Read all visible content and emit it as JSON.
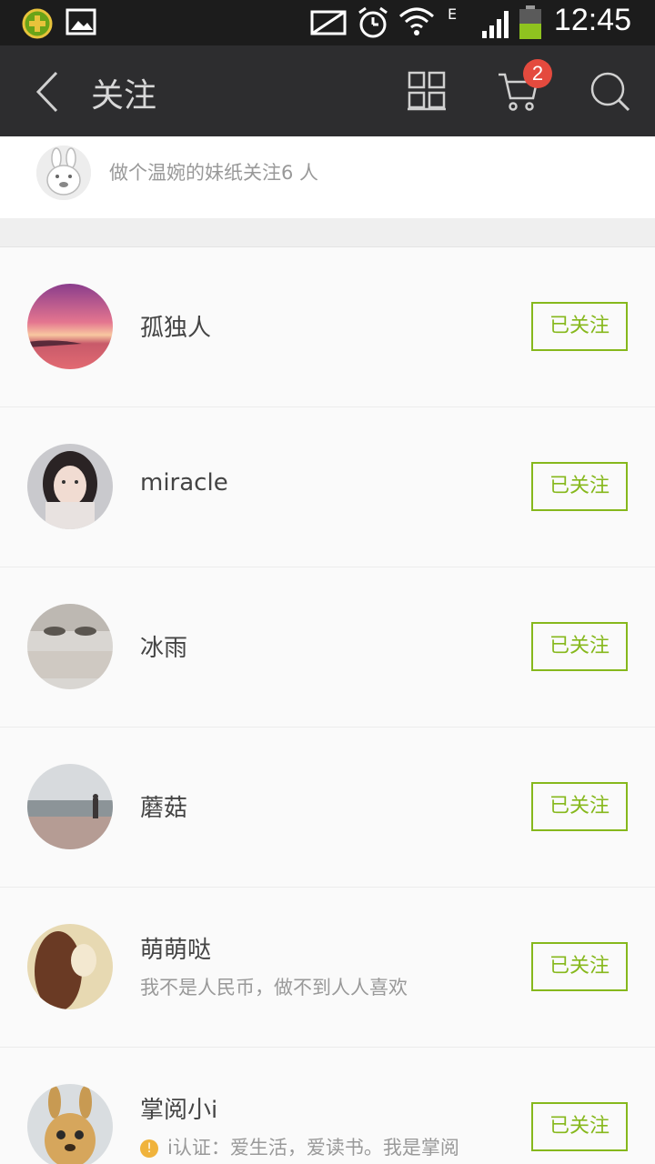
{
  "status_bar": {
    "time": "12:45",
    "network": "E"
  },
  "navbar": {
    "title": "关注",
    "cart_count": "2"
  },
  "summary": {
    "text": "做个温婉的妹纸关注6 人"
  },
  "list": [
    {
      "name": "孤独人",
      "bio": "",
      "button": "已关注"
    },
    {
      "name": "miracle",
      "bio": "",
      "button": "已关注"
    },
    {
      "name": "冰雨",
      "bio": "",
      "button": "已关注"
    },
    {
      "name": "蘑菇",
      "bio": "",
      "button": "已关注"
    },
    {
      "name": "萌萌哒",
      "bio": "我不是人民币，做不到人人喜欢",
      "button": "已关注"
    },
    {
      "name": "掌阅小i",
      "bio": "i认证：爱生活，爱读书。我是掌阅",
      "button": "已关注",
      "verified_icon": "!"
    }
  ],
  "colors": {
    "accent": "#86b81c",
    "navbar": "#2d2d2f",
    "badge": "#e44a3e"
  }
}
